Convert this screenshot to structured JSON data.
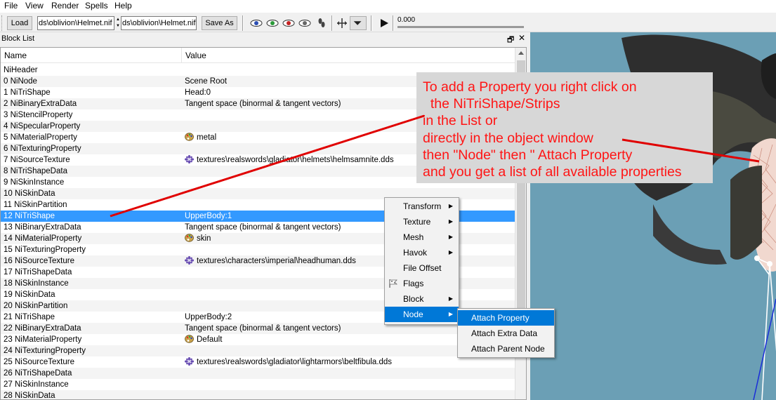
{
  "menubar": {
    "items": [
      "File",
      "View",
      "Render",
      "Spells",
      "Help"
    ]
  },
  "toolbar": {
    "load_label": "Load",
    "load_path": "ds\\oblivion\\Helmet.nif",
    "save_path": "ds\\oblivion\\Helmet.nif",
    "save_as_label": "Save As",
    "time_value": "0.000"
  },
  "panel": {
    "title": "Block List",
    "float_icon": "🗗",
    "close_icon": "✕"
  },
  "columns": {
    "name": "Name",
    "value": "Value"
  },
  "rows": [
    {
      "name": "NiHeader",
      "value": ""
    },
    {
      "name": "0  NiNode",
      "value": "Scene Root"
    },
    {
      "name": "1  NiTriShape",
      "value": "Head:0"
    },
    {
      "name": "2  NiBinaryExtraData",
      "value": "Tangent space (binormal & tangent vectors)"
    },
    {
      "name": "3  NiStencilProperty",
      "value": ""
    },
    {
      "name": "4  NiSpecularProperty",
      "value": ""
    },
    {
      "name": "5  NiMaterialProperty",
      "value": "metal",
      "icon": "palette-icon"
    },
    {
      "name": "6  NiTexturingProperty",
      "value": ""
    },
    {
      "name": "7  NiSourceTexture",
      "value": "textures\\realswords\\gladiator\\helmets\\helmsamnite.dds",
      "icon": "texture-icon"
    },
    {
      "name": "8  NiTriShapeData",
      "value": ""
    },
    {
      "name": "9  NiSkinInstance",
      "value": ""
    },
    {
      "name": "10  NiSkinData",
      "value": ""
    },
    {
      "name": "11  NiSkinPartition",
      "value": ""
    },
    {
      "name": "12  NiTriShape",
      "value": "UpperBody:1",
      "selected": true
    },
    {
      "name": "13  NiBinaryExtraData",
      "value": "Tangent space (binormal & tangent vectors)"
    },
    {
      "name": "14  NiMaterialProperty",
      "value": "skin",
      "icon": "palette-icon"
    },
    {
      "name": "15  NiTexturingProperty",
      "value": ""
    },
    {
      "name": "16  NiSourceTexture",
      "value": "textures\\characters\\imperial\\headhuman.dds",
      "icon": "texture-icon"
    },
    {
      "name": "17  NiTriShapeData",
      "value": ""
    },
    {
      "name": "18  NiSkinInstance",
      "value": ""
    },
    {
      "name": "19  NiSkinData",
      "value": ""
    },
    {
      "name": "20  NiSkinPartition",
      "value": ""
    },
    {
      "name": "21  NiTriShape",
      "value": "UpperBody:2"
    },
    {
      "name": "22  NiBinaryExtraData",
      "value": "Tangent space (binormal & tangent vectors)"
    },
    {
      "name": "23  NiMaterialProperty",
      "value": "Default",
      "icon": "palette-icon"
    },
    {
      "name": "24  NiTexturingProperty",
      "value": ""
    },
    {
      "name": "25  NiSourceTexture",
      "value": "textures\\realswords\\gladiator\\lightarmors\\beltfibula.dds",
      "icon": "texture-icon"
    },
    {
      "name": "26  NiTriShapeData",
      "value": ""
    },
    {
      "name": "27  NiSkinInstance",
      "value": ""
    },
    {
      "name": "28  NiSkinData",
      "value": ""
    }
  ],
  "context_menu": {
    "items": [
      {
        "label": "Transform",
        "submenu": true
      },
      {
        "label": "Texture",
        "submenu": true
      },
      {
        "label": "Mesh",
        "submenu": true
      },
      {
        "label": "Havok",
        "submenu": true
      },
      {
        "label": "File Offset",
        "submenu": false
      },
      {
        "label": "Flags",
        "submenu": false,
        "icon": "flag-icon"
      },
      {
        "label": "Block",
        "submenu": true
      },
      {
        "label": "Node",
        "submenu": true,
        "highlighted": true
      }
    ],
    "submenu_items": [
      {
        "label": "Attach Property",
        "highlighted": true
      },
      {
        "label": "Attach Extra Data"
      },
      {
        "label": "Attach Parent Node"
      }
    ]
  },
  "annotation": {
    "lines": [
      "To add a Property you right click on",
      "  the NiTriShape/Strips",
      "in the List or",
      "directly in the object window",
      "then \"Node\" then \" Attach Property",
      "and you get a list of all available properties"
    ],
    "text_color": "#ff1515",
    "background_color": "#d7d7d7"
  },
  "colors": {
    "selection": "#3399ff",
    "menu_highlight": "#0078d7",
    "viewport": "#6b9fb5"
  }
}
